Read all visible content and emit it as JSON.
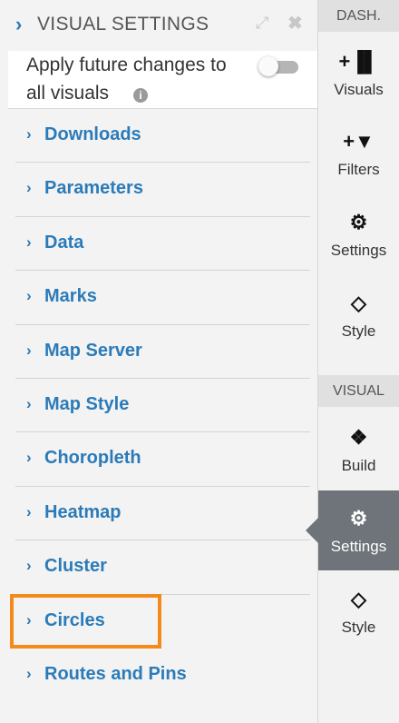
{
  "panel": {
    "title": "VISUAL SETTINGS",
    "apply_line1": "Apply future changes to",
    "apply_line2": "all visuals",
    "info_glyph": "i",
    "toggle_on": false
  },
  "menu": [
    {
      "label": "Downloads"
    },
    {
      "label": "Parameters"
    },
    {
      "label": "Data"
    },
    {
      "label": "Marks"
    },
    {
      "label": "Map Server"
    },
    {
      "label": "Map Style"
    },
    {
      "label": "Choropleth"
    },
    {
      "label": "Heatmap"
    },
    {
      "label": "Cluster"
    },
    {
      "label": "Circles"
    },
    {
      "label": "Routes and Pins"
    }
  ],
  "highlighted_item": "Circles",
  "rail": {
    "dash_header": "DASH.",
    "visual_header": "VISUAL",
    "dash_items": [
      {
        "label": "Visuals",
        "icon": "add-chart-icon"
      },
      {
        "label": "Filters",
        "icon": "add-filter-icon"
      },
      {
        "label": "Settings",
        "icon": "gears-icon"
      },
      {
        "label": "Style",
        "icon": "diamond-icon"
      }
    ],
    "visual_items": [
      {
        "label": "Build",
        "icon": "cubes-icon"
      },
      {
        "label": "Settings",
        "icon": "gears-icon",
        "active": true
      },
      {
        "label": "Style",
        "icon": "diamond-icon"
      }
    ]
  },
  "colors": {
    "link_blue": "#2b7bb9",
    "highlight_orange": "#f38a1a",
    "active_gray": "#6e7479"
  }
}
